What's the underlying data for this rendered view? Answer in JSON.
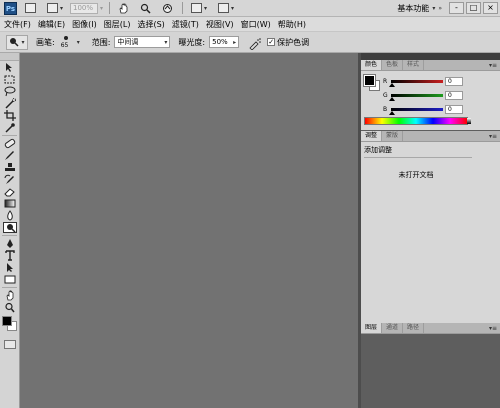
{
  "app": {
    "logo": "Ps",
    "zoom_placeholder": "100%",
    "workspace_label": "基本功能",
    "window_controls": [
      "-",
      "□",
      "×"
    ]
  },
  "menu": [
    "文件(F)",
    "编辑(E)",
    "图像(I)",
    "图层(L)",
    "选择(S)",
    "滤镜(T)",
    "视图(V)",
    "窗口(W)",
    "帮助(H)"
  ],
  "options": {
    "brush_label": "画笔:",
    "brush_size": "65",
    "range_label": "范围:",
    "range_value": "中间调",
    "exposure_label": "曝光度:",
    "exposure_value": "50%",
    "protect_tones_label": "保护色调",
    "protect_tones_checked": true
  },
  "tools": [
    "move-icon",
    "marquee-icon",
    "lasso-icon",
    "quick-select-icon",
    "crop-icon",
    "eyedropper-icon",
    "healing-icon",
    "brush-icon",
    "clone-stamp-icon",
    "history-brush-icon",
    "eraser-icon",
    "gradient-icon",
    "blur-icon",
    "dodge-icon",
    "pen-icon",
    "type-icon",
    "path-select-icon",
    "shape-icon",
    "hand-icon",
    "zoom-icon"
  ],
  "active_tool": "dodge-icon",
  "colors": {
    "foreground": "#000000",
    "background": "#ffffff"
  },
  "color_panel": {
    "tabs": [
      "颜色",
      "色板",
      "样式"
    ],
    "channels": [
      {
        "name": "R",
        "value": "0",
        "color": "#c81e1e"
      },
      {
        "name": "G",
        "value": "0",
        "color": "#1e9a1e"
      },
      {
        "name": "B",
        "value": "0",
        "color": "#1e1ec8"
      }
    ]
  },
  "adjust_panel": {
    "tabs": [
      "调整",
      "蒙版"
    ],
    "title": "添加调整",
    "message": "未打开文档"
  },
  "layers_panel": {
    "tabs": [
      "图层",
      "通道",
      "路径"
    ]
  }
}
